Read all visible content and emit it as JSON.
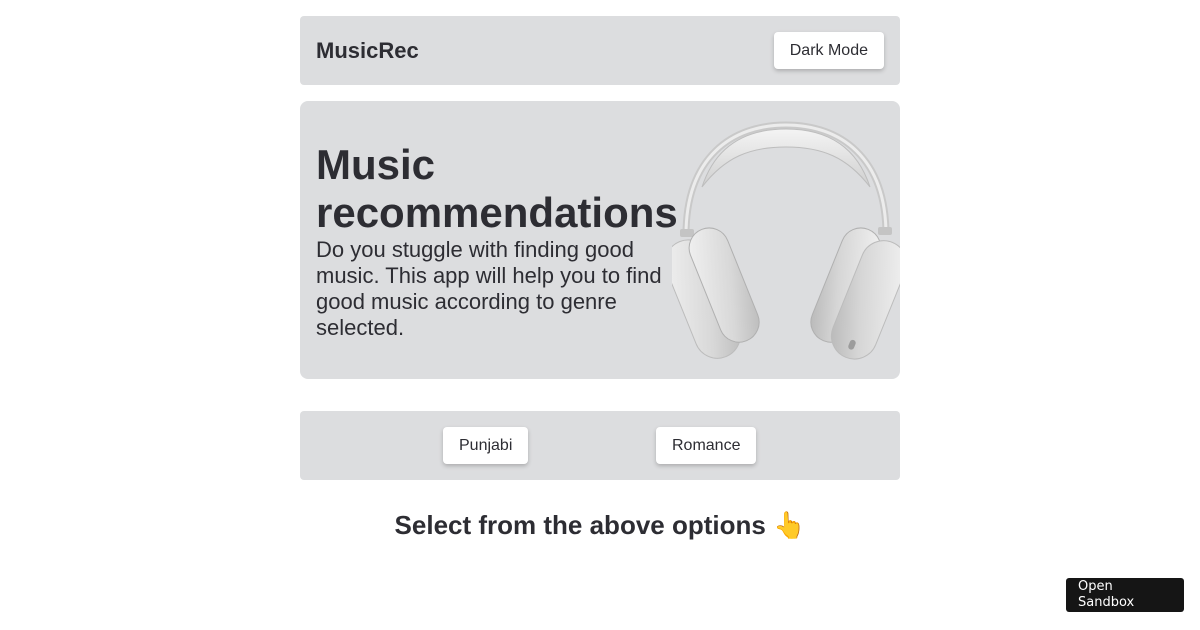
{
  "navbar": {
    "brand": "MusicRec",
    "theme_toggle_label": "Dark Mode"
  },
  "hero": {
    "title": "Music recommendations",
    "description": "Do you stuggle with finding good music. This app will help you to find good music according to genre selected.",
    "image": "headphones-image"
  },
  "genres": {
    "options": [
      "Punjabi",
      "Romance"
    ]
  },
  "hint": {
    "text": "Select from the above options",
    "emoji": "👆"
  },
  "sandbox": {
    "label": "Open Sandbox"
  }
}
